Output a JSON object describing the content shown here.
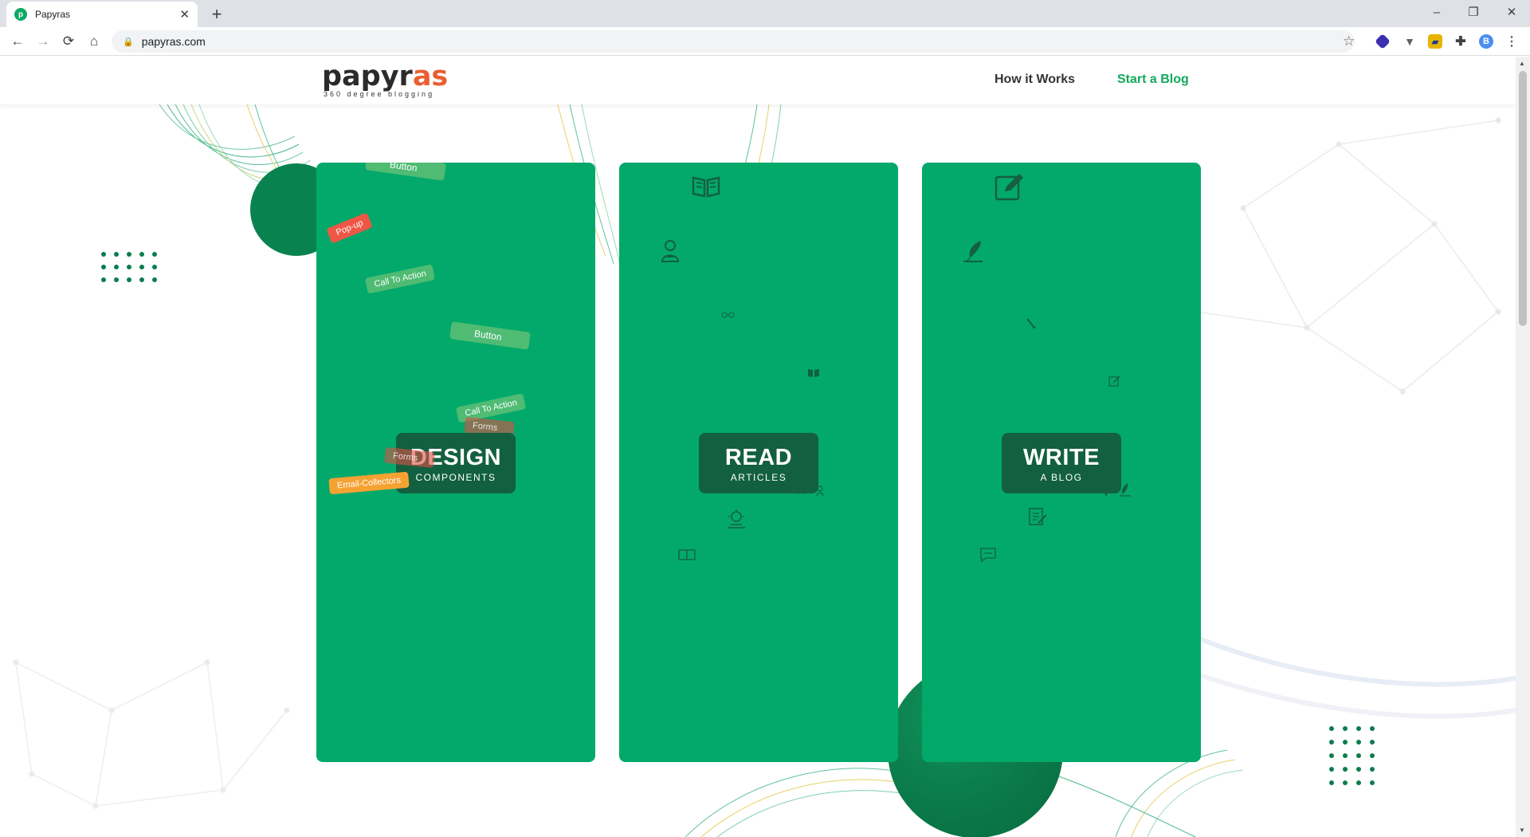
{
  "browser": {
    "tab_title": "Papyras",
    "tab_favicon_letter": "p",
    "tab_close": "✕",
    "new_tab": "+",
    "window_minimize": "–",
    "window_restore": "❐",
    "window_close": "✕",
    "back": "←",
    "forward": "→",
    "reload": "⟳",
    "home": "⌂",
    "url": "papyras.com",
    "lock": "🔒",
    "star": "☆",
    "menu": "⋮"
  },
  "site": {
    "logo": {
      "prefix": "papyr",
      "accent": "as",
      "tagline": "360 degree blogging"
    },
    "nav": [
      {
        "label": "How it Works"
      },
      {
        "label": "Start a Blog"
      }
    ],
    "accent_color": "#13a85c",
    "card_color": "#02a96a"
  },
  "cards": [
    {
      "title": "DESIGN",
      "subtitle": "COMPONENTS",
      "chips": [
        "Button",
        "Pop-up",
        "Call To Action",
        "Button",
        "Call To Action",
        "Forms",
        "Forms",
        "Email-Collectors"
      ]
    },
    {
      "title": "READ",
      "subtitle": "ARTICLES",
      "icons": [
        "open-book-icon",
        "reader-icon",
        "glasses-icon",
        "book-icon",
        "idea-icon"
      ]
    },
    {
      "title": "WRITE",
      "subtitle": "A BLOG",
      "icons": [
        "edit-icon",
        "quill-icon",
        "pen-icon",
        "note-icon",
        "clipboard-icon",
        "chat-icon"
      ]
    }
  ]
}
